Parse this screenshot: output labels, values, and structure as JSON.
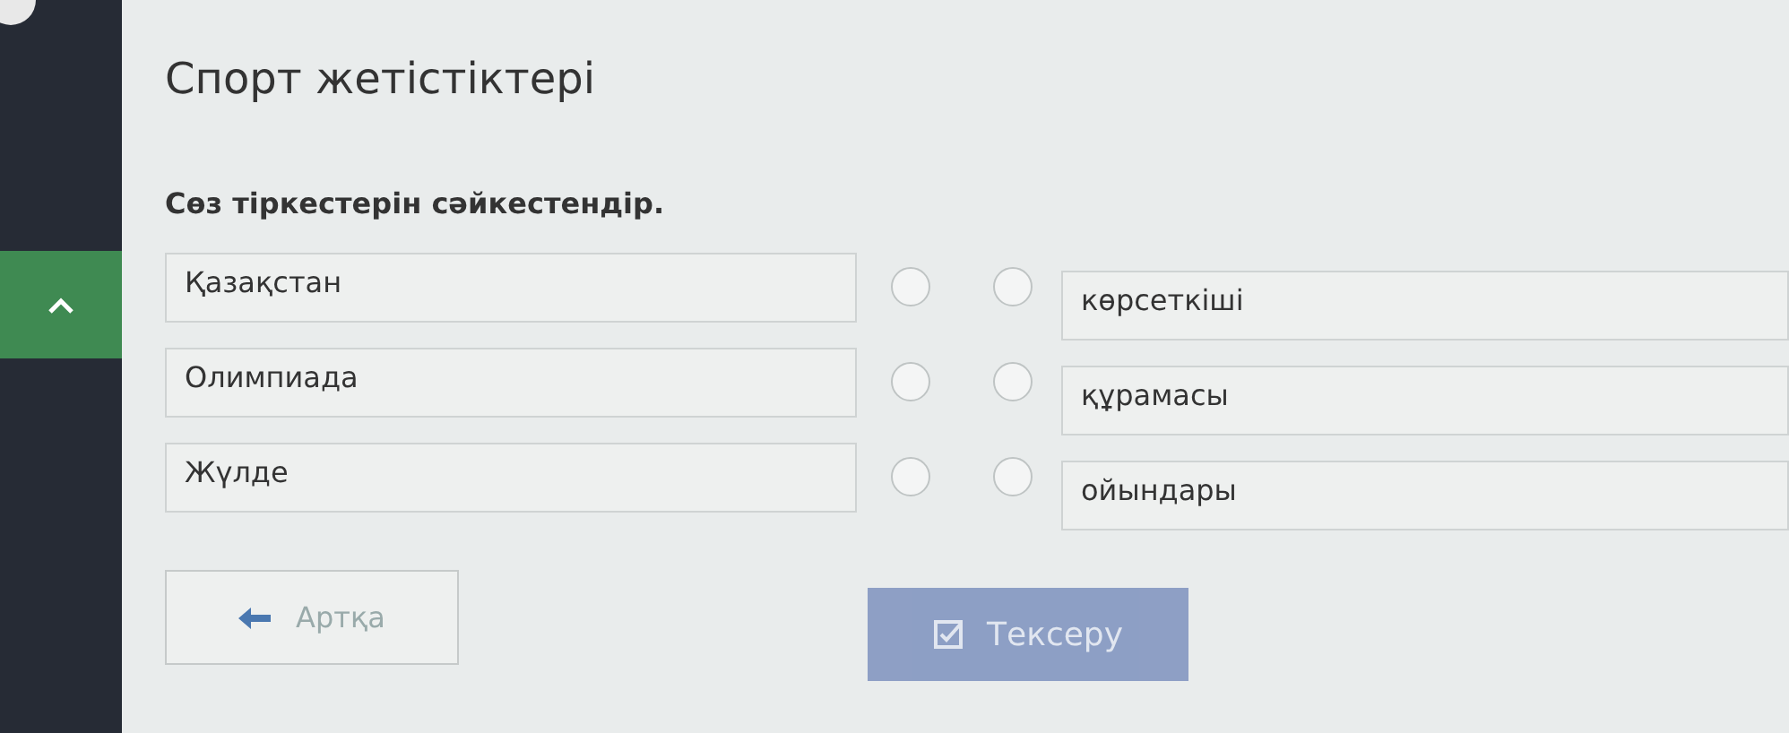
{
  "title": "Спорт жетістіктері",
  "instruction": "Сөз тіркестерін сәйкестендір.",
  "left_items": [
    {
      "label": "Қазақстан",
      "selected": false
    },
    {
      "label": "Олимпиада",
      "selected": false
    },
    {
      "label": "Жүлде",
      "selected": false
    }
  ],
  "right_items": [
    {
      "label": "көрсеткіші",
      "selected": false
    },
    {
      "label": "құрамасы",
      "selected": false
    },
    {
      "label": "ойындары",
      "selected": false
    }
  ],
  "back_button": {
    "label": "Артқа"
  },
  "check_button": {
    "label": "Тексеру",
    "disabled": true
  }
}
